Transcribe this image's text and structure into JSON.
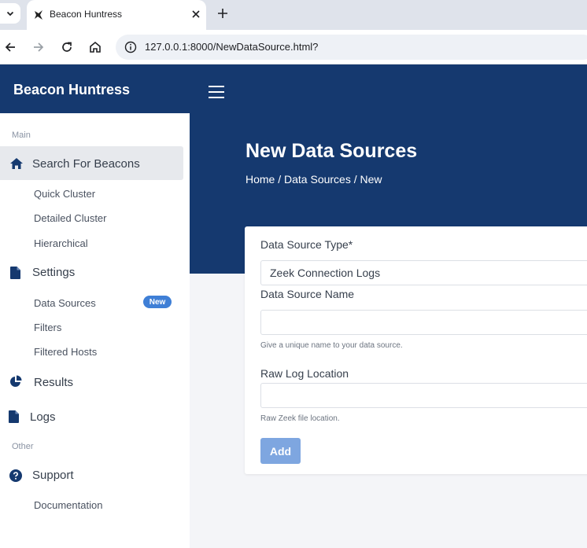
{
  "browser": {
    "tab_title": "Beacon Huntress",
    "url": "127.0.0.1:8000/NewDataSource.html?"
  },
  "sidebar": {
    "brand": "Beacon Huntress",
    "section_main": "Main",
    "search_for_beacons": "Search For Beacons",
    "quick_cluster": "Quick Cluster",
    "detailed_cluster": "Detailed Cluster",
    "hierarchical": "Hierarchical",
    "settings": "Settings",
    "data_sources": "Data Sources",
    "data_sources_badge": "New",
    "filters": "Filters",
    "filtered_hosts": "Filtered Hosts",
    "results": "Results",
    "logs": "Logs",
    "section_other": "Other",
    "support": "Support",
    "documentation": "Documentation"
  },
  "header": {
    "page_title": "New Data Sources",
    "breadcrumb": "Home / Data Sources / New"
  },
  "form": {
    "type_label": "Data Source Type*",
    "type_value": "Zeek Connection Logs",
    "name_label": "Data Source Name",
    "name_help": "Give a unique name to your data source.",
    "log_label": "Raw Log Location",
    "log_help": "Raw Zeek file location.",
    "add_button": "Add"
  },
  "colors": {
    "brand_navy": "#15396f",
    "badge_blue": "#3f7fd6",
    "button_blue": "#7ea6e0"
  }
}
